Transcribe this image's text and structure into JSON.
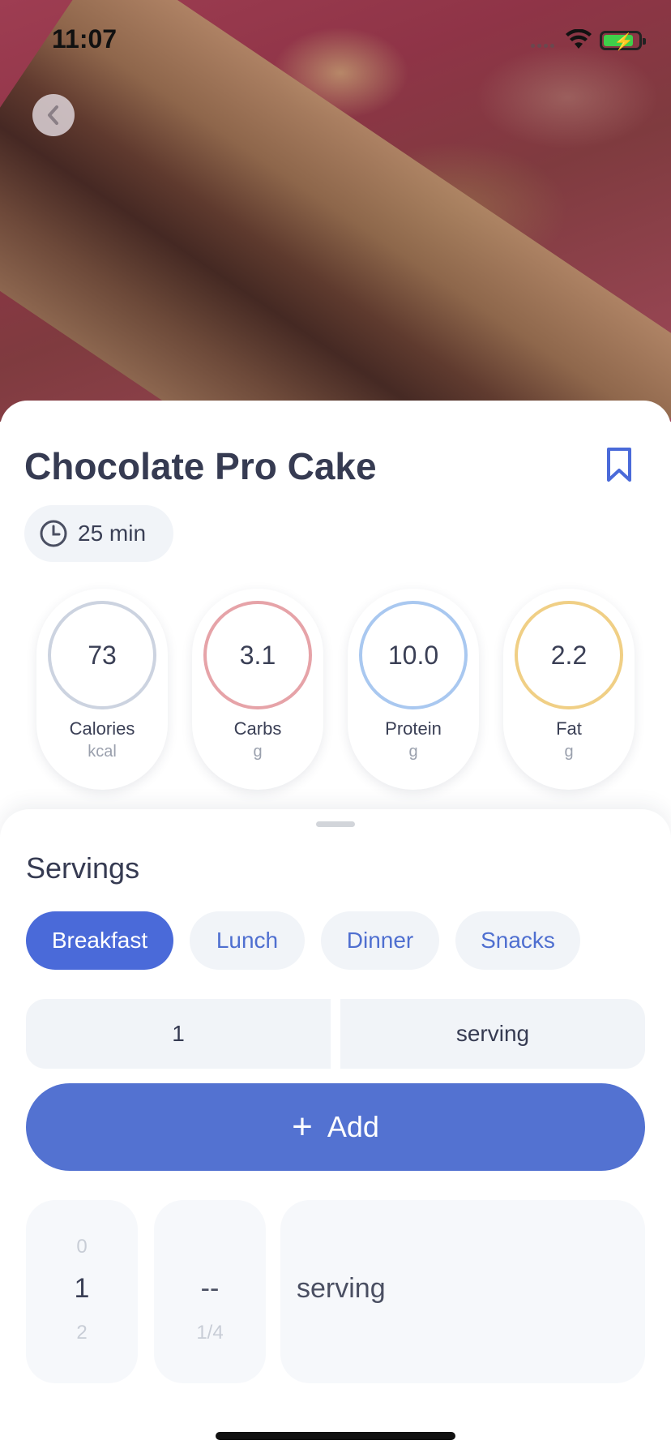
{
  "status_bar": {
    "time": "11:07"
  },
  "recipe": {
    "title": "Chocolate Pro Cake",
    "time": "25 min"
  },
  "nutrition": [
    {
      "value": "73",
      "label": "Calories",
      "unit": "kcal",
      "color": "#ccd3e0"
    },
    {
      "value": "3.1",
      "label": "Carbs",
      "unit": "g",
      "color": "#e6a3a8"
    },
    {
      "value": "10.0",
      "label": "Protein",
      "unit": "g",
      "color": "#a9c8f0"
    },
    {
      "value": "2.2",
      "label": "Fat",
      "unit": "g",
      "color": "#f0cf85"
    }
  ],
  "servings": {
    "title": "Servings",
    "meals": [
      "Breakfast",
      "Lunch",
      "Dinner",
      "Snacks"
    ],
    "selected_meal": "Breakfast",
    "quantity": "1",
    "unit": "serving",
    "add_label": "Add"
  },
  "picker": {
    "whole": {
      "prev": "0",
      "current": "1",
      "next": "2"
    },
    "fraction": {
      "current": "--",
      "next": "1/4"
    },
    "unit": "serving"
  },
  "colors": {
    "accent": "#4a6ad9",
    "add_button": "#5372d1"
  }
}
